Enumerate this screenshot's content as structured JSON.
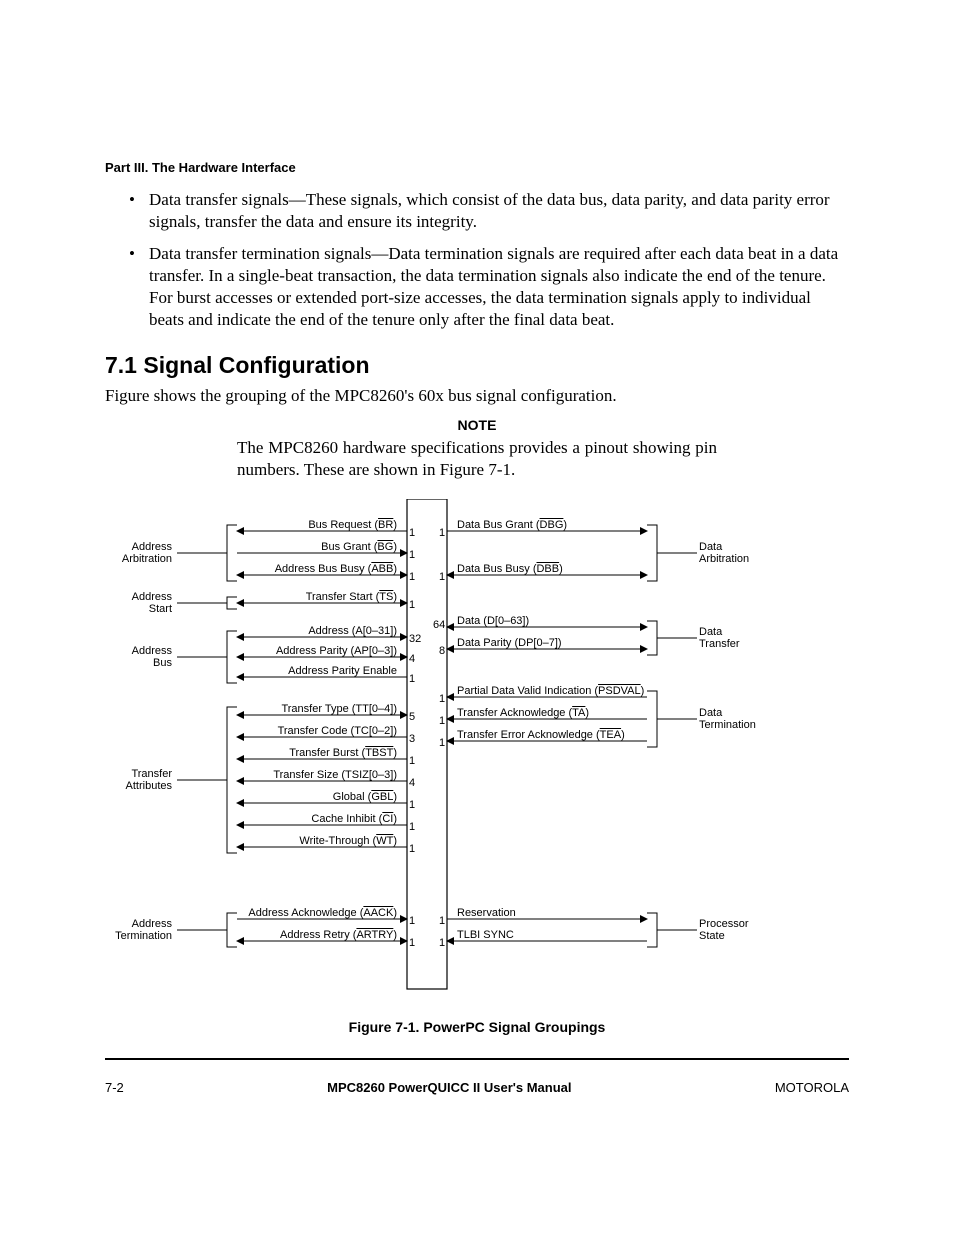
{
  "header": {
    "part": "Part III. The Hardware Interface"
  },
  "bullets": [
    "Data transfer signals—These signals, which consist of the data bus, data parity, and data parity error signals, transfer the data and ensure its integrity.",
    "Data transfer termination signals—Data termination signals are required after each data beat in a data transfer. In a single-beat transaction, the data termination signals also indicate the end of the tenure. For burst accesses or extended port-size accesses, the data termination signals apply to individual beats and indicate the end of the tenure only after the final data beat."
  ],
  "section": {
    "number": "7.1",
    "title": "Signal Configuration",
    "intro": "Figure  shows the grouping of the MPC8260's 60x bus signal configuration."
  },
  "note": {
    "heading": "NOTE",
    "text": "The MPC8260 hardware specifications provides a pinout showing pin numbers. These are shown in Figure 7-1."
  },
  "figure": {
    "caption": "Figure 7-1. PowerPC Signal Groupings",
    "left_groups": [
      {
        "name": "Address\nArbitration"
      },
      {
        "name": "Address\nStart"
      },
      {
        "name": "Address\nBus"
      },
      {
        "name": "Transfer\nAttributes"
      },
      {
        "name": "Address\nTermination"
      }
    ],
    "right_groups": [
      {
        "name": "Data\nArbitration"
      },
      {
        "name": "Data\nTransfer"
      },
      {
        "name": "Data\nTermination"
      },
      {
        "name": "Processor\nState"
      }
    ],
    "left_signals": [
      {
        "label": "Bus Request (",
        "ov": "BR",
        "label2": ")",
        "width": "1"
      },
      {
        "label": "Bus Grant (",
        "ov": "BG",
        "label2": ")",
        "width": "1"
      },
      {
        "label": "Address Bus Busy (",
        "ov": "ABB",
        "label2": ")",
        "width": "1"
      },
      {
        "label": "Transfer Start (",
        "ov": "TS",
        "label2": ")",
        "width": "1"
      },
      {
        "label": "Address (A[0–31])",
        "width": "32"
      },
      {
        "label": "Address Parity (AP[0–3])",
        "width": "4"
      },
      {
        "label": "Address Parity Enable",
        "width": "1"
      },
      {
        "label": "Transfer Type (TT[0–4])",
        "width": "5"
      },
      {
        "label": "Transfer Code (TC[0–2])",
        "width": "3"
      },
      {
        "label": "Transfer Burst (",
        "ov": "TBST",
        "label2": ")",
        "width": "1"
      },
      {
        "label": "Transfer Size (TSIZ[0–3])",
        "width": "4"
      },
      {
        "label": "Global (",
        "ov": "GBL",
        "label2": ")",
        "width": "1"
      },
      {
        "label": "Cache Inhibit (",
        "ov": "CI",
        "label2": ")",
        "width": "1"
      },
      {
        "label": "Write-Through (",
        "ov": "WT",
        "label2": ")",
        "width": "1"
      },
      {
        "label": "Address Acknowledge (",
        "ov": "AACK",
        "label2": ")",
        "width": "1"
      },
      {
        "label": "Address Retry (",
        "ov": "ARTRY",
        "label2": ")",
        "width": "1"
      }
    ],
    "right_signals": [
      {
        "label": "Data Bus Grant (",
        "ov": "DBG",
        "label2": ")",
        "width": "1"
      },
      {
        "label": "Data Bus Busy (",
        "ov": "DBB",
        "label2": ")",
        "width": "1"
      },
      {
        "label": "Data (D[0–63])",
        "width": "64"
      },
      {
        "label": "Data Parity (DP[0–7])",
        "width": "8"
      },
      {
        "label": "Partial Data Valid Indication (",
        "ov": "PSDVAL",
        "label2": ")",
        "width": "1"
      },
      {
        "label": "Transfer Acknowledge (",
        "ov": "TA",
        "label2": ")",
        "width": "1"
      },
      {
        "label": "Transfer Error Acknowledge (",
        "ov": "TEA",
        "label2": ")",
        "width": "1"
      },
      {
        "label": "Reservation",
        "width": "1"
      },
      {
        "label": "TLBI SYNC",
        "width": "1"
      }
    ]
  },
  "footer": {
    "page": "7-2",
    "title": "MPC8260 PowerQUICC II User's Manual",
    "brand": "MOTOROLA"
  }
}
